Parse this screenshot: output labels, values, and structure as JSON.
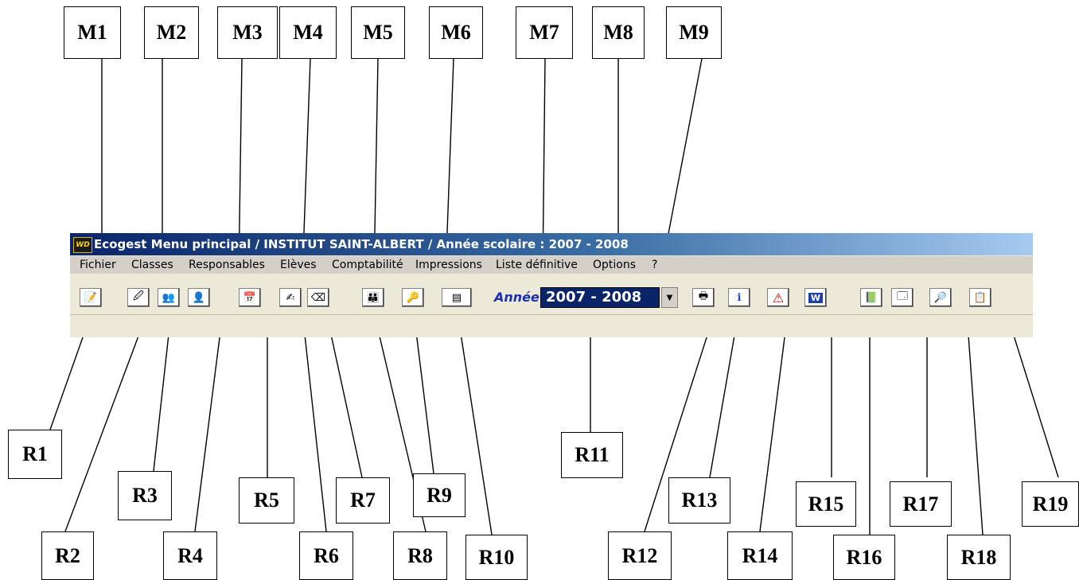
{
  "window": {
    "app_icon": "WD",
    "title": "Ecogest Menu principal / INSTITUT SAINT-ALBERT / Année scolaire : 2007 - 2008"
  },
  "menu": [
    "Fichier",
    "Classes",
    "Responsables",
    "Elèves",
    "Comptabilité",
    "Impressions",
    "Liste définitive",
    "Options",
    "?"
  ],
  "toolbar": {
    "buttons": [
      {
        "icon": "notes-icon",
        "glyph": "📝"
      },
      {
        "icon": "edit-window-icon",
        "glyph": "🖉"
      },
      {
        "icon": "people-icon",
        "glyph": "👥"
      },
      {
        "icon": "person-red-icon",
        "glyph": "👤"
      },
      {
        "icon": "calendar-icon",
        "glyph": "📅"
      },
      {
        "icon": "pen-edit-icon",
        "glyph": "✍"
      },
      {
        "icon": "eraser-icon",
        "glyph": "⌫"
      },
      {
        "icon": "users-group-icon",
        "glyph": "👪"
      },
      {
        "icon": "key-icon",
        "glyph": "🔑"
      },
      {
        "icon": "card-icon",
        "glyph": "▤"
      },
      {
        "icon": "printer-icon",
        "glyph": "🖶"
      },
      {
        "icon": "info-person-icon",
        "glyph": "ℹ"
      },
      {
        "icon": "warning-icon",
        "glyph": "⚠"
      },
      {
        "icon": "word-icon",
        "glyph": "W"
      },
      {
        "icon": "book-edit-icon",
        "glyph": "📗"
      },
      {
        "icon": "window-settings-icon",
        "glyph": "🗔"
      },
      {
        "icon": "magnifier-icon",
        "glyph": "🔎"
      },
      {
        "icon": "document-edit-icon",
        "glyph": "📋"
      }
    ],
    "year_label": "Année",
    "year_value": "2007 - 2008"
  },
  "annotations": {
    "top": [
      "M1",
      "M2",
      "M3",
      "M4",
      "M5",
      "M6",
      "M7",
      "M8",
      "M9"
    ],
    "bottom": [
      "R1",
      "R2",
      "R3",
      "R4",
      "R5",
      "R6",
      "R7",
      "R8",
      "R9",
      "R10",
      "R11",
      "R12",
      "R13",
      "R14",
      "R15",
      "R16",
      "R17",
      "R18",
      "R19"
    ]
  }
}
